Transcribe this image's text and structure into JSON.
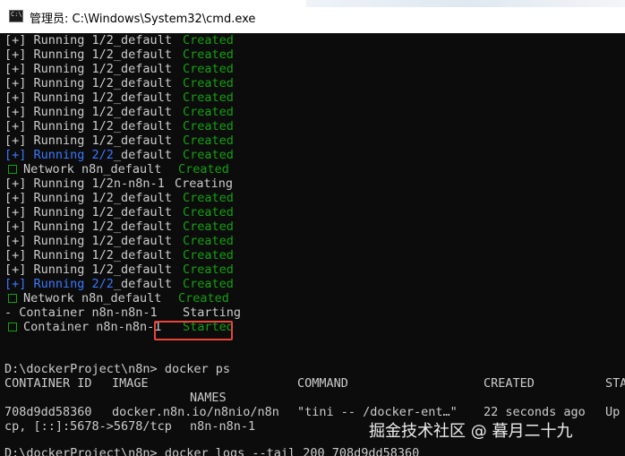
{
  "window": {
    "title": "管理员: C:\\Windows\\System32\\cmd.exe",
    "icon": "cmd-icon"
  },
  "terminal": {
    "log_lines": [
      {
        "prefix": "[+] Running 1/2",
        "name": "_default",
        "status": "Created",
        "status_color": "green",
        "box": false,
        "prefix_color": "default"
      },
      {
        "prefix": "[+] Running 1/2",
        "name": "_default",
        "status": "Created",
        "status_color": "green",
        "box": false,
        "prefix_color": "default"
      },
      {
        "prefix": "[+] Running 1/2",
        "name": "_default",
        "status": "Created",
        "status_color": "green",
        "box": false,
        "prefix_color": "default"
      },
      {
        "prefix": "[+] Running 1/2",
        "name": "_default",
        "status": "Created",
        "status_color": "green",
        "box": false,
        "prefix_color": "default"
      },
      {
        "prefix": "[+] Running 1/2",
        "name": "_default",
        "status": "Created",
        "status_color": "green",
        "box": false,
        "prefix_color": "default"
      },
      {
        "prefix": "[+] Running 1/2",
        "name": "_default",
        "status": "Created",
        "status_color": "green",
        "box": false,
        "prefix_color": "default"
      },
      {
        "prefix": "[+] Running 1/2",
        "name": "_default",
        "status": "Created",
        "status_color": "green",
        "box": false,
        "prefix_color": "default"
      },
      {
        "prefix": "[+] Running 1/2",
        "name": "_default",
        "status": "Created",
        "status_color": "green",
        "box": false,
        "prefix_color": "default"
      },
      {
        "prefix": "[+] Running 2/2",
        "name": "_default",
        "status": "Created",
        "status_color": "green",
        "box": false,
        "prefix_color": "blue"
      },
      {
        "prefix": "Network n8n",
        "name": "_default",
        "status": "Created",
        "status_color": "green",
        "box": true,
        "prefix_color": "default"
      },
      {
        "prefix": "[+] Running 1/2",
        "name": "n-n8n-1",
        "status": "Creating",
        "status_color": "default",
        "box": false,
        "prefix_color": "default"
      },
      {
        "prefix": "[+] Running 1/2",
        "name": "_default",
        "status": "Created",
        "status_color": "green",
        "box": false,
        "prefix_color": "default"
      },
      {
        "prefix": "[+] Running 1/2",
        "name": "_default",
        "status": "Created",
        "status_color": "green",
        "box": false,
        "prefix_color": "default"
      },
      {
        "prefix": "[+] Running 1/2",
        "name": "_default",
        "status": "Created",
        "status_color": "green",
        "box": false,
        "prefix_color": "default"
      },
      {
        "prefix": "[+] Running 1/2",
        "name": "_default",
        "status": "Created",
        "status_color": "green",
        "box": false,
        "prefix_color": "default"
      },
      {
        "prefix": "[+] Running 1/2",
        "name": "_default",
        "status": "Created",
        "status_color": "green",
        "box": false,
        "prefix_color": "default"
      },
      {
        "prefix": "[+] Running 1/2",
        "name": "_default",
        "status": "Created",
        "status_color": "green",
        "box": false,
        "prefix_color": "default"
      },
      {
        "prefix": "[+] Running 2/2",
        "name": "_default",
        "status": "Created",
        "status_color": "green",
        "box": false,
        "prefix_color": "blue"
      },
      {
        "prefix": "Network n8n",
        "name": "_default",
        "status": "Created",
        "status_color": "green",
        "box": true,
        "prefix_color": "default"
      },
      {
        "prefix": "- Container n8n-n8n-1",
        "name": "",
        "status": "Starting",
        "status_color": "default",
        "box": false,
        "prefix_color": "default"
      },
      {
        "prefix": "Container n8n-n8n-1",
        "name": "",
        "status": "Started",
        "status_color": "green",
        "box": true,
        "prefix_color": "default"
      }
    ],
    "prompt": "D:\\dockerProject\\n8n>",
    "command": "docker ps",
    "ps_headers": {
      "container_id": "CONTAINER ID",
      "image": "IMAGE",
      "command": "COMMAND",
      "created": "CREATED",
      "status": "STA",
      "names": "NAMES"
    },
    "ps_row": {
      "container_id": "708d9dd58360",
      "image": "docker.n8n.io/n8nio/n8n",
      "command": "\"tini -- /docker-ent…\"",
      "created": "22 seconds ago",
      "status": "Up",
      "ports": "cp, [::]:5678->5678/tcp",
      "names": "n8n-n8n-1"
    },
    "next_prompt": "D:\\dockerProject\\n8n>",
    "next_command": "docker logs --tail 200 708d9dd58360"
  },
  "colors": {
    "background": "#0c0c0c",
    "text": "#cccccc",
    "green": "#13a10e",
    "blue": "#3b78ff",
    "highlight": "#e8443a"
  },
  "watermark": {
    "text": "掘金技术社区 @ 暮月二十九"
  }
}
